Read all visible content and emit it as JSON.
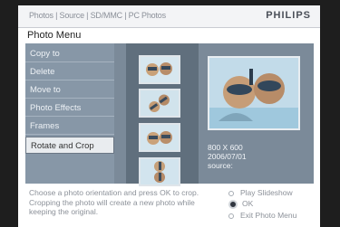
{
  "header": {
    "breadcrumb": "Photos | Source | SD/MMC | PC Photos",
    "brand": "PHILIPS"
  },
  "menu": {
    "title": "Photo Menu",
    "items": [
      {
        "label": "Copy to"
      },
      {
        "label": "Delete"
      },
      {
        "label": "Move to"
      },
      {
        "label": "Photo Effects"
      },
      {
        "label": "Frames"
      },
      {
        "label": "Rotate and Crop",
        "selected": true
      }
    ]
  },
  "preview": {
    "resolution": "800 X 600",
    "date": "2006/07/01",
    "source_label": "source:"
  },
  "footer": {
    "help_line1": "Choose a photo orientation and press OK to crop.",
    "help_line2": "Cropping the photo will create a new photo while",
    "help_line3": "keeping the original.",
    "play_slideshow": "Play Slideshow",
    "ok": "OK",
    "exit": "Exit Photo Menu"
  },
  "colors": {
    "panel": "#7b8a99",
    "menu": "#8797a7",
    "strip": "#606f7d",
    "selected": "#e9ecef"
  }
}
